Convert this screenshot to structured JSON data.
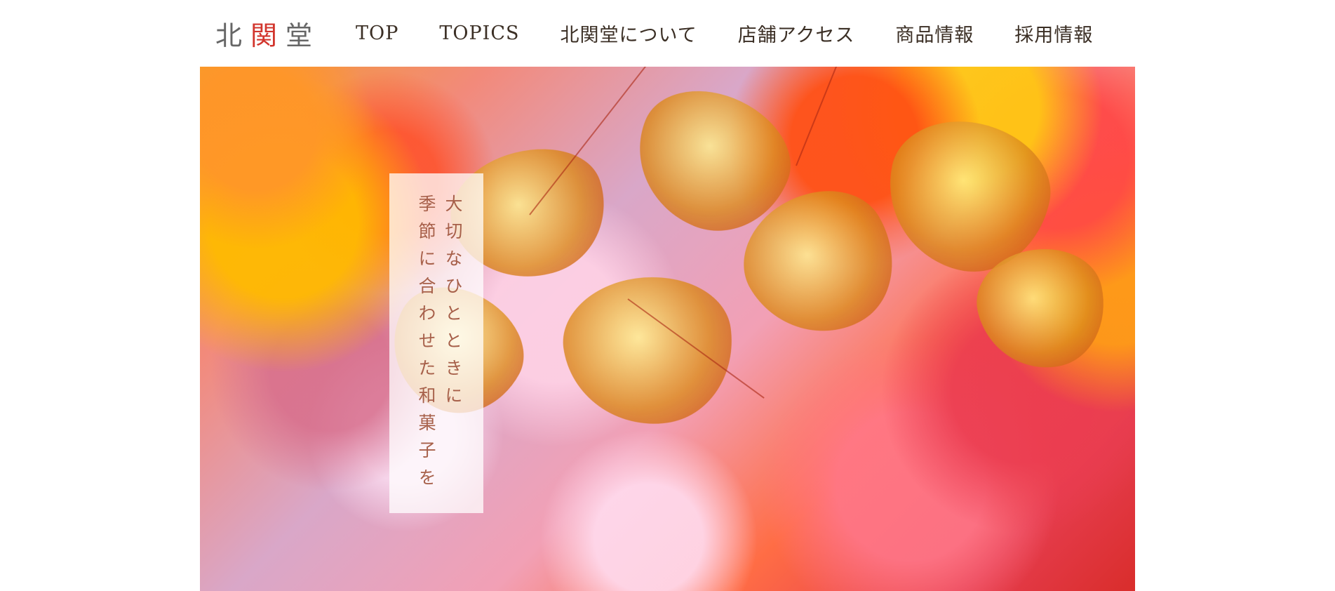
{
  "header": {
    "logo": {
      "part1": "北",
      "part2": "関",
      "part3": "堂"
    },
    "nav": [
      {
        "label": "TOP"
      },
      {
        "label": "TOPICS"
      },
      {
        "label": "北関堂について"
      },
      {
        "label": "店舗アクセス"
      },
      {
        "label": "商品情報"
      },
      {
        "label": "採用情報"
      }
    ]
  },
  "hero": {
    "tagline_line_1": "大切なひとときに",
    "tagline_line_2": "季節に合わせた和菓子を"
  },
  "colors": {
    "logo_accent": "#d2352d",
    "nav_text": "#3b2f25",
    "tagline_text": "#a7604a"
  }
}
